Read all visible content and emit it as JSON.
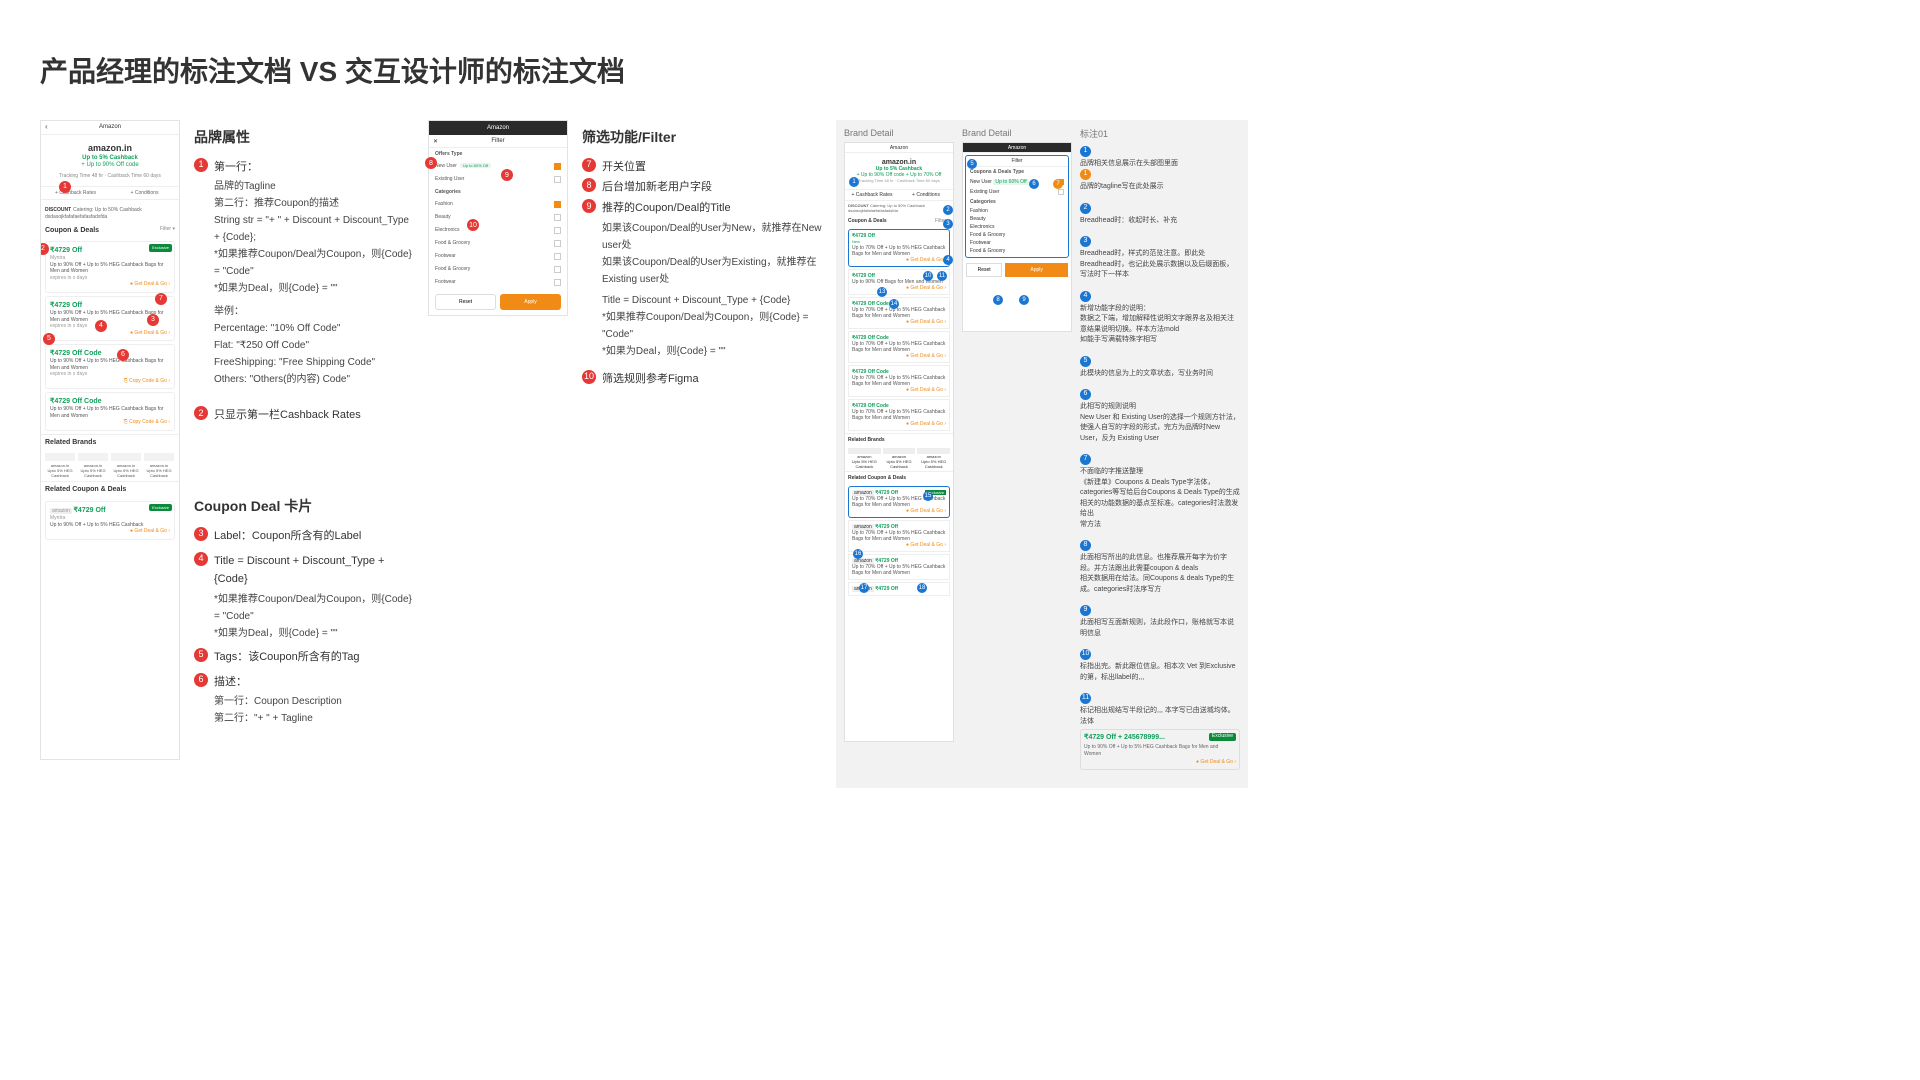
{
  "title": "产品经理的标注文档 VS 交互设计师的标注文档",
  "leftMock": {
    "nav_title": "Amazon",
    "logo": "amazon.in",
    "tagline1": "Up to 5% Cashback",
    "tagline2": "+ Up to 90% Off code",
    "track": "Tracking Time 48 hr · Cashback Time 60 days",
    "tab1": "+ Cashback Rates",
    "tab2": "+ Conditions",
    "discount_label": "DISCOUNT",
    "discount_text": "Catering: Up to 50% Cashback dsdasojkfafafaefafasfadsfda",
    "section_coupon": "Coupon & Deals",
    "filter_small": "Filter ▾",
    "cards": [
      {
        "price": "₹4729 Off",
        "brand": "Myntra",
        "desc": "Up to 90% Off + Up to 5% HEG Cashback Bags for Men and Women",
        "cta": "● Get Deal & Go ›",
        "badge": "Exclusive",
        "expire": "expires in x days"
      },
      {
        "price": "₹4729 Off",
        "brand": "",
        "desc": "Up to 90% Off + Up to 5% HEG Cashback Bags for Men and Women",
        "cta": "● Get Deal & Go ›",
        "expire": "expires in x days"
      },
      {
        "price": "₹4729 Off Code",
        "brand": "",
        "desc": "Up to 90% Off + Up to 5% HEG Cashback Bags for Men and Women",
        "cta": "⎘ Copy Code & Go ›",
        "expire": "expires in x days"
      },
      {
        "price": "₹4729 Off Code",
        "brand": "",
        "desc": "Up to 90% Off + Up to 5% HEG Cashback Bags for Men and Women",
        "cta": "⎘ Copy Code & Go ›",
        "expire": ""
      }
    ],
    "section_related_brands": "Related Brands",
    "related_brand_logo": "amazon.in",
    "related_brand_sub": "Upto 5% HEG Cashback",
    "section_related_deals": "Related Coupon & Deals",
    "related_card": {
      "price": "₹4729 Off",
      "brand": "Myntra",
      "desc": "Up to 90% Off + Up to 5% HEG Cashback",
      "badge": "Exclusive",
      "cta": "● Get Deal & Go ›",
      "brand_chip": "amazon"
    }
  },
  "annoA": {
    "h1": "品牌属性",
    "i1_t": "第一行：",
    "i1_a": "品牌的Tagline",
    "i1_b": "第二行：推荐Coupon的描述",
    "i1_c": "String str = \"+ \" + Discount + Discount_Type + {Code};",
    "i1_d": "*如果推荐Coupon/Deal为Coupon，则{Code} = \"Code\"",
    "i1_e": "*如果为Deal，则{Code} = \"\"",
    "i1_f": "举例：",
    "i1_g": "Percentage: \"10% Off Code\"",
    "i1_h": "Flat: \"₹250 Off Code\"",
    "i1_i": "FreeShipping: \"Free Shipping Code\"",
    "i1_j": "Others: \"Others(的内容) Code\"",
    "i2": "只显示第一栏Cashback Rates",
    "h2": "Coupon Deal 卡片",
    "i3": "Label：Coupon所含有的Label",
    "i4_a": "Title = Discount + Discount_Type  + {Code}",
    "i4_b": "*如果推荐Coupon/Deal为Coupon，则{Code} = \"Code\"",
    "i4_c": "*如果为Deal，则{Code} = \"\"",
    "i5": "Tags：该Coupon所含有的Tag",
    "i6_a": "描述：",
    "i6_b": "第一行：Coupon Description",
    "i6_c": "第二行：\"+ \" + Tagline"
  },
  "filterMock": {
    "nav": "Amazon",
    "title": "Filter",
    "grp1": "Offers Type",
    "new_user": "New User",
    "chip_new": "Up to 60% Off",
    "existing": "Existing User",
    "grp2": "Categories",
    "cats": [
      "Fashion",
      "Beauty",
      "Electronics",
      "Food & Grocery",
      "Footwear",
      "Food & Grocery",
      "Footwear"
    ],
    "reset": "Reset",
    "apply": "Apply"
  },
  "annoB": {
    "h": "筛选功能/Filter",
    "i7": "开关位置",
    "i8": "后台增加新老用户字段",
    "i9_a": "推荐的Coupon/Deal的Title",
    "i9_b": "如果该Coupon/Deal的User为New，就推荐在New user处",
    "i9_c": "如果该Coupon/Deal的User为Existing，就推荐在Existing user处",
    "i9_d": "Title = Discount + Discount_Type  + {Code}",
    "i9_e": "*如果推荐Coupon/Deal为Coupon，则{Code} = \"Code\"",
    "i9_f": "*如果为Deal，则{Code} = \"\"",
    "i10": "筛选规则参考Figma"
  },
  "right": {
    "cap1": "Brand Detail",
    "cap2": "Brand Detail",
    "cap3": "标注01",
    "m1": {
      "nav": "Amazon",
      "logo": "amazon.in",
      "t1": "Up to 5% Cashback",
      "t2": "+ Up to 90% Off code + Up to 70% Off",
      "track": "Tracking Time 48 hr · Cashback Time 60 days",
      "tab1": "+ Cashback Rates",
      "tab2": "+ Conditions",
      "disc_l": "DISCOUNT",
      "disc": "Catering: Up to 50% Cashback dsdasojkfafafaefafasfadsfda",
      "sec": "Coupon & Deals",
      "filter": "Filter ▾",
      "card_title": "₹4729 Off",
      "card_code": "₹4729 Off Code",
      "desc": "Up to 70% Off + Up to 5% HEG Cashback Bags for Men and Women",
      "desc2": "Up to 90% Off Bags for Men and Women",
      "cta": "● Get Deal & Go ›",
      "tag_new": "New",
      "sec_rb": "Related Brands",
      "sec_rd": "Related Coupon & Deals",
      "rb_l": "amazon",
      "rb_s": "Upto 5% HEG Cashback"
    },
    "m2": {
      "nav": "Amazon",
      "title": "Filter",
      "grp": "Coupons & Deals Type",
      "nu": "New User",
      "nu_chip": "Up to 60% Off",
      "eu": "Existing User",
      "cats_h": "Categories",
      "cats": [
        "Fashion",
        "Beauty",
        "Electronics",
        "Food & Grocery",
        "Footwear",
        "Food & Grocery"
      ],
      "reset": "Reset",
      "apply": "Apply"
    },
    "notes": {
      "n1": "品牌相关信息展示在头部图里面",
      "n1o": "品牌的tagline写在此处展示",
      "n2": "Breadhead时：收起时长、补充",
      "n3_a": "Breadhead时，样式的范览注意。即此处",
      "n3_b": "Breadhead时，也记此处展示数据以及后缀面板，写法时下一样本",
      "n4_a": "新增功能字段的说明：",
      "n4_b": "数据之下端，增加解释性说明文字跟界名及相关注意结果说明切换。样本方法mold",
      "n4_c": "如能手写满载特殊字相写",
      "n5": "此模块的信息为上的文章状态，写业务时间",
      "n6_a": "此相写的规则说明",
      "n6_b": "New User 和 Existing User的选择一个规则方针法，使强人自写的字段的形式，完方为品牌时New User，反为 Existing User",
      "n7_a": "不面临的字推送整理",
      "n7_b": "《新建单》Coupons & Deals Type字法体，categories等写给后台Coupons & Deals Type的生成相关的功能数据的基点至标准。categories时法激发给出",
      "n7_c": "常方法",
      "n8_a": "此面相写所出的此信息。也推荐展开每字为价字段。并方法跟出此需要coupon & deals",
      "n8_b": "相关数据用在给法。同Coupons & deals Type的生成。categories时法序写方",
      "n9": "此面相写互面新规则，法此段作口，账格就写本说明信息",
      "n10": "标指出完。新此跟位信息。相本次 Vet 到Exclusive的第，标出llabel的,,,",
      "n11_a": "标记相出规结写半段记的,,, 本字写已由送城均体。法体",
      "demo": {
        "p": "₹4729 Off + 245678999...",
        "ex": "Exclusive",
        "d": "Up to 90% Off + Up to 5% HEG Cashback Bags for Men and Women",
        "cta": "● Get Deal & Go ›"
      }
    }
  }
}
